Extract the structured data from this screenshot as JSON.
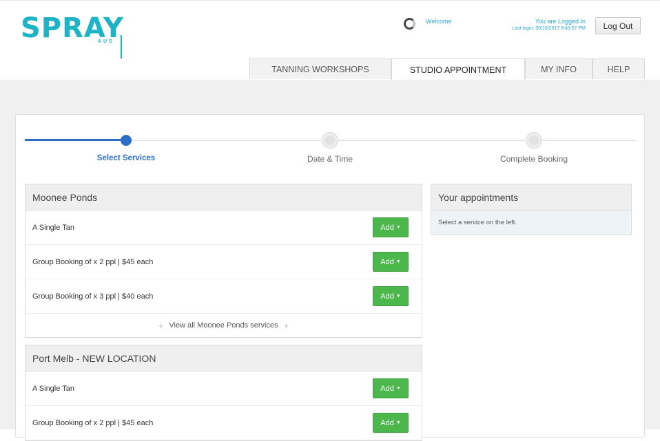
{
  "header": {
    "logo_text": "SPRAY",
    "logo_sub": "AUS",
    "welcome": "Welcome",
    "logged_in": "You are Logged In",
    "last_login": "Last login: 30/10/2017 8:43:57 PM",
    "logout_label": "Log Out"
  },
  "tabs": [
    {
      "label": "TANNING WORKSHOPS",
      "active": false
    },
    {
      "label": "STUDIO APPOINTMENT",
      "active": true
    },
    {
      "label": "MY INFO",
      "active": false
    },
    {
      "label": "HELP",
      "active": false
    }
  ],
  "progress": {
    "steps": [
      {
        "label": "Select Services",
        "state": "current"
      },
      {
        "label": "Date & Time",
        "state": "pending"
      },
      {
        "label": "Complete Booking",
        "state": "pending"
      }
    ]
  },
  "locations": [
    {
      "name": "Moonee Ponds",
      "services": [
        {
          "name": "A Single Tan",
          "button": "Add"
        },
        {
          "name": "Group Booking of x 2 ppl | $45 each",
          "button": "Add"
        },
        {
          "name": "Group Booking of x 3 ppl | $40 each",
          "button": "Add"
        }
      ],
      "view_all": "View all Moonee Ponds services"
    },
    {
      "name": "Port Melb - NEW LOCATION",
      "services": [
        {
          "name": "A Single Tan",
          "button": "Add"
        },
        {
          "name": "Group Booking of x 2 ppl | $45 each",
          "button": "Add"
        }
      ]
    }
  ],
  "appointments": {
    "title": "Your appointments",
    "empty_text": "Select a service on the left."
  },
  "colors": {
    "brand": "#1fb3c6",
    "progress_active": "#2d6fc4",
    "add_button": "#4cb84c",
    "welcome_text": "#2aa6d6"
  }
}
